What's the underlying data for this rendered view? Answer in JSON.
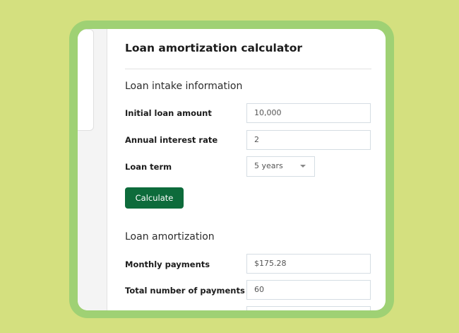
{
  "app": {
    "title": "Loan amortization calculator"
  },
  "intake": {
    "heading": "Loan intake information",
    "fields": [
      {
        "label": "Initial loan amount",
        "value": "10,000"
      },
      {
        "label": "Annual interest rate",
        "value": "2"
      },
      {
        "label": "Loan term",
        "value": "5 years"
      }
    ],
    "calculate_label": "Calculate"
  },
  "amortization": {
    "heading": "Loan amortization",
    "fields": [
      {
        "label": "Monthly payments",
        "value": "$175.28"
      },
      {
        "label": "Total number of payments",
        "value": "60"
      },
      {
        "label": "",
        "value": ""
      }
    ]
  },
  "colors": {
    "page_background": "#d4e07f",
    "frame": "#9fd174",
    "accent_button": "#0d6b3b"
  },
  "icons": {
    "select_arrow": "chevron-down-icon"
  }
}
